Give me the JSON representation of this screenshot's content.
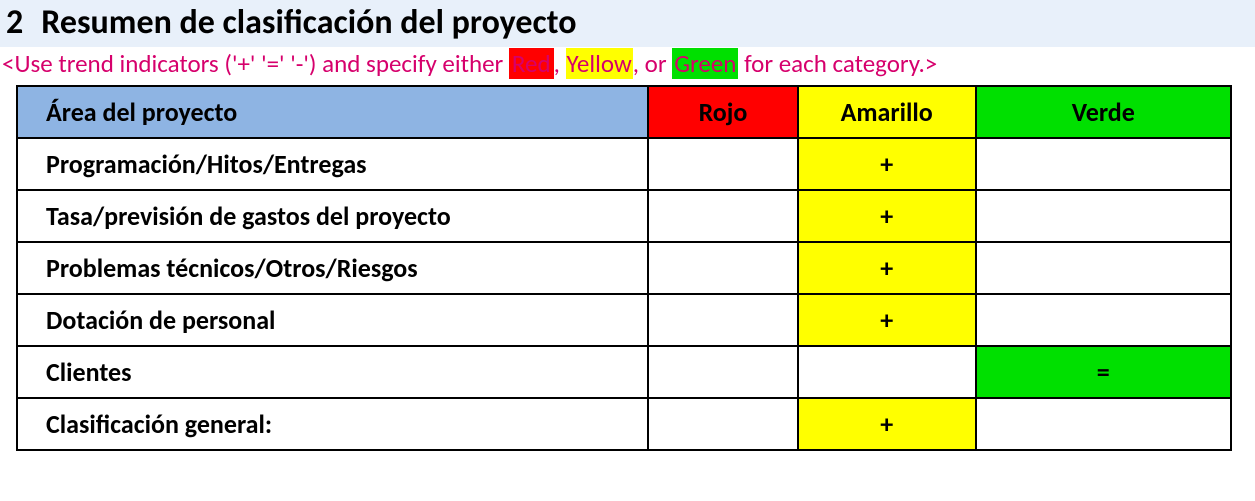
{
  "header": {
    "number": "2",
    "title": "Resumen de clasificación del proyecto"
  },
  "instruction": {
    "pre": "<Use trend indicators ('+' '=' '-') and specify either ",
    "red": "Red",
    "sep1": ", ",
    "yellow": "Yellow",
    "sep2": ", or ",
    "green": "Green",
    "post": " for each category.>"
  },
  "table": {
    "headers": {
      "area": "Área del proyecto",
      "rojo": "Rojo",
      "amarillo": "Amarillo",
      "verde": "Verde"
    },
    "rows": [
      {
        "area": "Programación/Hitos/Entregas",
        "rojo": "",
        "amarillo": "+",
        "verde": "",
        "hl": "amarillo"
      },
      {
        "area": "Tasa/previsión de gastos del proyecto",
        "rojo": "",
        "amarillo": "+",
        "verde": "",
        "hl": "amarillo"
      },
      {
        "area": "Problemas técnicos/Otros/Riesgos",
        "rojo": "",
        "amarillo": "+",
        "verde": "",
        "hl": "amarillo"
      },
      {
        "area": "Dotación de personal",
        "rojo": "",
        "amarillo": "+",
        "verde": "",
        "hl": "amarillo"
      },
      {
        "area": "Clientes",
        "rojo": "",
        "amarillo": "",
        "verde": "=",
        "hl": "verde"
      },
      {
        "area": "Clasificación general:",
        "rojo": "",
        "amarillo": "+",
        "verde": "",
        "hl": "amarillo"
      }
    ]
  }
}
